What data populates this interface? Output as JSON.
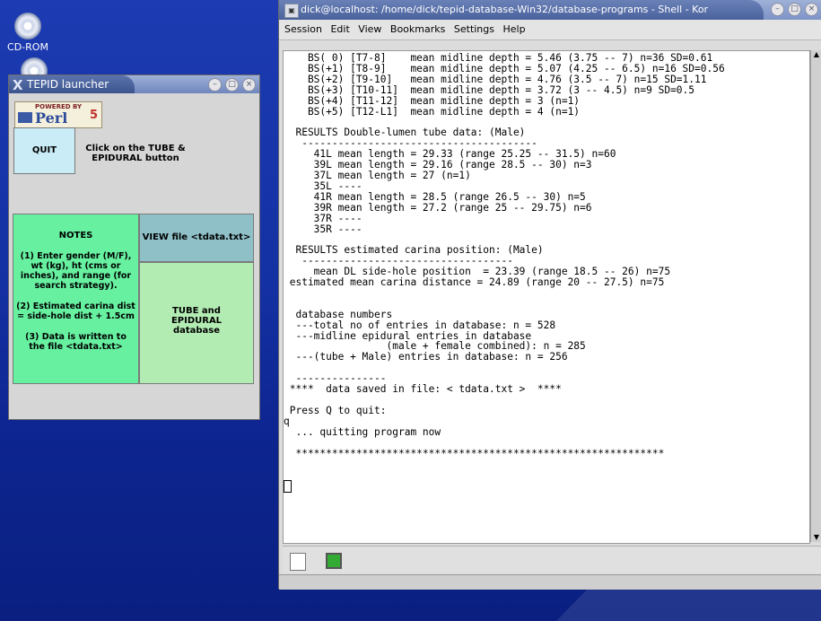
{
  "desktop": {
    "icons": [
      {
        "label": "CD-ROM",
        "icon": "cd-rom-icon"
      },
      {
        "label": "",
        "icon": "cd-rom-icon"
      }
    ]
  },
  "launcher": {
    "title": "TEPID launcher",
    "perl_logo": {
      "powered_by": "POWERED BY",
      "name": "Perl",
      "version": "5"
    },
    "quit_label": "QUIT",
    "instruction_line1": "Click on the TUBE &",
    "instruction_line2": "EPIDURAL button",
    "notes": {
      "title": "NOTES",
      "lines": [
        "(1) Enter gender (M/F),",
        "wt (kg), ht (cms or",
        "inches), and range (for",
        "search strategy).",
        "(2) Estimated carina dist",
        "= side-hole dist + 1.5cm",
        "(3) Data is written to",
        "the file <tdata.txt>"
      ]
    },
    "view_label": "VIEW file <tdata.txt>",
    "tube_label_line1": "TUBE and",
    "tube_label_line2": "EPIDURAL",
    "tube_label_line3": "database"
  },
  "terminal": {
    "title": "dick@localhost: /home/dick/tepid-database-Win32/database-programs - Shell - Kor",
    "menu": [
      "Session",
      "Edit",
      "View",
      "Bookmarks",
      "Settings",
      "Help"
    ],
    "lines": [
      "    BS( 0) [T7-8]    mean midline depth = 5.46 (3.75 -- 7) n=36 SD=0.61",
      "    BS(+1) [T8-9]    mean midline depth = 5.07 (4.25 -- 6.5) n=16 SD=0.56",
      "    BS(+2) [T9-10]   mean midline depth = 4.76 (3.5 -- 7) n=15 SD=1.11",
      "    BS(+3) [T10-11]  mean midline depth = 3.72 (3 -- 4.5) n=9 SD=0.5",
      "    BS(+4) [T11-12]  mean midline depth = 3 (n=1)",
      "    BS(+5) [T12-L1]  mean midline depth = 4 (n=1)",
      "",
      "  RESULTS Double-lumen tube data: (Male)",
      "   ---------------------------------------",
      "     41L mean length = 29.33 (range 25.25 -- 31.5) n=60",
      "     39L mean length = 29.16 (range 28.5 -- 30) n=3",
      "     37L mean length = 27 (n=1)",
      "     35L ----",
      "     41R mean length = 28.5 (range 26.5 -- 30) n=5",
      "     39R mean length = 27.2 (range 25 -- 29.75) n=6",
      "     37R ----",
      "     35R ----",
      "",
      "  RESULTS estimated carina position: (Male)",
      "   -----------------------------------",
      "     mean DL side-hole position  = 23.39 (range 18.5 -- 26) n=75",
      " estimated mean carina distance = 24.89 (range 20 -- 27.5) n=75",
      "",
      "",
      "  database numbers",
      "  ---total no of entries in database: n = 528",
      "  ---midline epidural entries in database",
      "                 (male + female combined): n = 285",
      "  ---(tube + Male) entries in database: n = 256",
      "",
      "  ---------------",
      " ****  data saved in file: < tdata.txt >  ****",
      "",
      " Press Q to quit:",
      "q",
      "  ... quitting program now",
      "",
      "  *************************************************************",
      "",
      ""
    ]
  }
}
